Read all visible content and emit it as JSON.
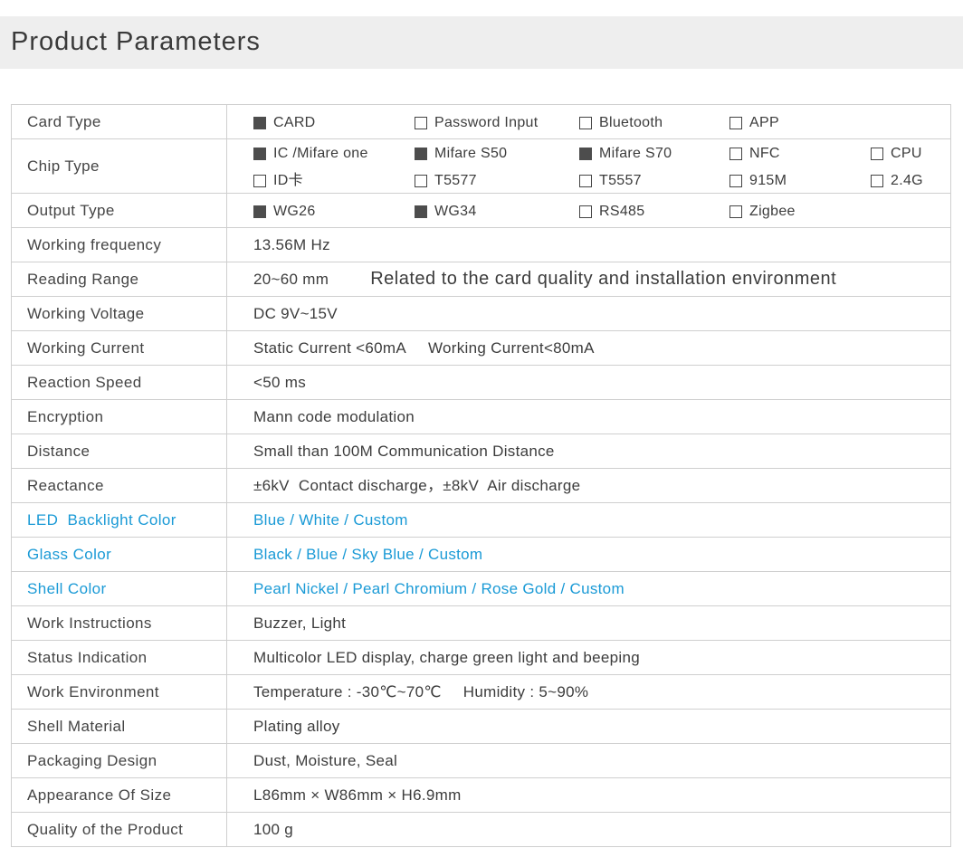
{
  "page_title": "Product Parameters",
  "colors": {
    "accent": "#1a9ad6",
    "header_bg": "#eeeeee",
    "border": "#cfcfcf",
    "checked": "#4d4d4d"
  },
  "rows": {
    "card_type": {
      "label": "Card Type",
      "options": [
        {
          "label": "CARD",
          "checked": true
        },
        {
          "label": "Password Input",
          "checked": false
        },
        {
          "label": "Bluetooth",
          "checked": false
        },
        {
          "label": "APP",
          "checked": false
        }
      ]
    },
    "chip_type": {
      "label": "Chip Type",
      "options_row1": [
        {
          "label": "IC /Mifare one",
          "checked": true
        },
        {
          "label": "Mifare S50",
          "checked": true
        },
        {
          "label": "Mifare S70",
          "checked": true
        },
        {
          "label": "NFC",
          "checked": false
        },
        {
          "label": "CPU",
          "checked": false
        }
      ],
      "options_row2": [
        {
          "label": "ID卡",
          "checked": false
        },
        {
          "label": "T5577",
          "checked": false
        },
        {
          "label": "T5557",
          "checked": false
        },
        {
          "label": "915M",
          "checked": false
        },
        {
          "label": "2.4G",
          "checked": false
        }
      ]
    },
    "output_type": {
      "label": "Output Type",
      "options": [
        {
          "label": "WG26",
          "checked": true
        },
        {
          "label": "WG34",
          "checked": true
        },
        {
          "label": "RS485",
          "checked": false
        },
        {
          "label": "Zigbee",
          "checked": false
        }
      ]
    },
    "working_frequency": {
      "label": "Working frequency",
      "value": "13.56M Hz"
    },
    "reading_range": {
      "label": "Reading Range",
      "value": "20~60 mm",
      "note": "Related to the card quality and installation environment"
    },
    "working_voltage": {
      "label": "Working Voltage",
      "value": "DC 9V~15V"
    },
    "working_current": {
      "label": "Working Current",
      "value": "Static Current <60mA",
      "value2": "Working Current<80mA"
    },
    "reaction_speed": {
      "label": "Reaction Speed",
      "value": "<50 ms"
    },
    "encryption": {
      "label": "Encryption",
      "value": "Mann code modulation"
    },
    "distance": {
      "label": "Distance",
      "value": "Small than 100M Communication Distance"
    },
    "reactance": {
      "label": "Reactance",
      "value": "±6kV  Contact discharge，±8kV  Air discharge"
    },
    "led_backlight": {
      "label": "LED  Backlight Color",
      "value": "Blue / White / Custom"
    },
    "glass_color": {
      "label": "Glass Color",
      "value": "Black / Blue / Sky Blue / Custom"
    },
    "shell_color": {
      "label": "Shell Color",
      "value": "Pearl Nickel / Pearl Chromium / Rose Gold / Custom"
    },
    "work_instructions": {
      "label": "Work Instructions",
      "value": "Buzzer, Light"
    },
    "status_indication": {
      "label": "Status Indication",
      "value": "Multicolor LED display, charge green light and beeping"
    },
    "work_environment": {
      "label": "Work Environment",
      "value": "Temperature : -30℃~70℃",
      "value2": "Humidity : 5~90%"
    },
    "shell_material": {
      "label": "Shell Material",
      "value": "Plating alloy"
    },
    "packaging_design": {
      "label": "Packaging Design",
      "value": "Dust, Moisture, Seal"
    },
    "appearance_size": {
      "label": "Appearance Of Size",
      "value": "L86mm × W86mm × H6.9mm"
    },
    "quality": {
      "label": "Quality of the Product",
      "value": "100 g"
    }
  }
}
